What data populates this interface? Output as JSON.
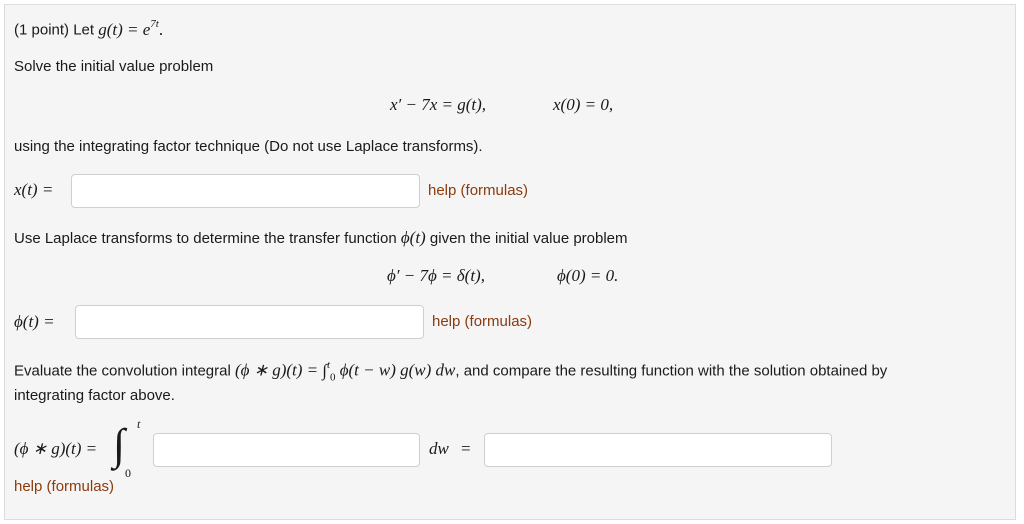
{
  "problem": {
    "intro": "(1 point) Let",
    "g_def_lhs": "g(t) = e",
    "g_def_exp": "7t",
    "g_def_end": ".",
    "solve_text": "Solve the initial value problem",
    "ode1": "x′ − 7x = g(t),",
    "ic1": "x(0) = 0,",
    "using_text": "using the integrating factor technique (Do not use Laplace transforms).",
    "x_label": "x(t) =",
    "help1": "help (formulas)",
    "laplace_text_a": "Use Laplace transforms to determine the transfer function",
    "laplace_phi": "ϕ(t)",
    "laplace_text_b": "given the initial value problem",
    "ode2": "ϕ′ − 7ϕ = δ(t),",
    "ic2": "ϕ(0) = 0.",
    "phi_label": "ϕ(t) =",
    "help2": "help (formulas)",
    "conv_text_a": "Evaluate the convolution integral",
    "conv_expr": "(ϕ ∗ g)(t) =",
    "conv_int": "∫",
    "conv_int_upper": "t",
    "conv_int_lower": "0",
    "conv_integrand": "ϕ(t − w) g(w) dw",
    "conv_text_b": ", and compare the resulting function with the solution obtained by",
    "conv_text_c": "integrating factor above.",
    "conv_label": "(ϕ ∗ g)(t) =",
    "int_upper": "t",
    "int_lower": "0",
    "dw_label": "dw",
    "eq_sign": "=",
    "help3": "help (formulas)"
  },
  "inputs": {
    "x_answer": "",
    "phi_answer": "",
    "integrand_answer": "",
    "conv_answer": ""
  },
  "colors": {
    "help_link": "#8b3a0e",
    "panel_bg": "#f5f5f5"
  }
}
